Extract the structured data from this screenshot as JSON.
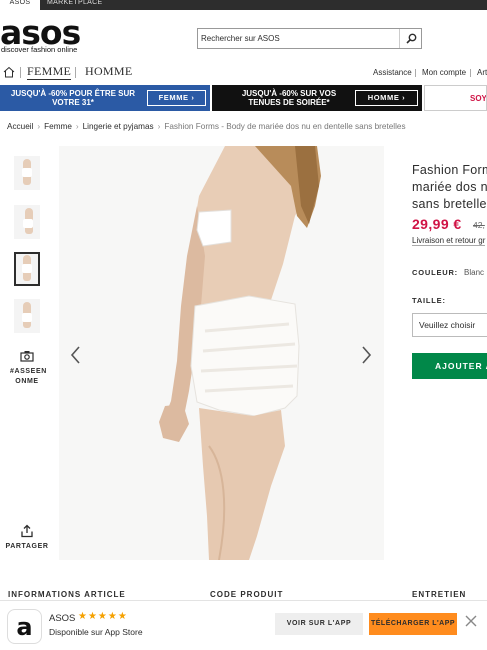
{
  "topbar": {
    "tab_active": "ASOS",
    "tab_marketplace": "MARKETPLACE"
  },
  "logo": {
    "word": "asos",
    "tagline": "discover fashion online"
  },
  "search": {
    "placeholder": "Rechercher sur ASOS"
  },
  "nav": {
    "categories": [
      "FEMME",
      "HOMME"
    ],
    "utilities": [
      "Assistance",
      "Mon compte",
      "Art"
    ]
  },
  "promos": [
    {
      "text": "JUSQU'À -60% POUR ÊTRE SUR VOTRE 31*",
      "button": "FEMME ›",
      "bg": "#2b5aa5"
    },
    {
      "text": "JUSQU'À -60% SUR VOS TENUES DE SOIRÉE*",
      "button": "HOMME ›",
      "bg": "#111111"
    },
    {
      "text": "SOYE",
      "accent": "#d01345"
    }
  ],
  "breadcrumb": [
    "Accueil",
    "Femme",
    "Lingerie et pyjamas",
    "Fashion Forms - Body de mariée dos nu en dentelle sans bretelles"
  ],
  "gallery": {
    "thumb_count": 4,
    "selected_index": 2,
    "share_tag": "#ASSEEN ONME",
    "share_label": "PARTAGER"
  },
  "product": {
    "title_lines": [
      "Fashion Form",
      "mariée dos n",
      "sans bretelles"
    ],
    "price": "29,99 €",
    "old_price": "42,",
    "price_color": "#d01345",
    "delivery": "Livraison et retour gr",
    "color_label": "COULEUR:",
    "color_value": "Blanc",
    "size_label": "TAILLE:",
    "size_placeholder": "Veuillez choisir",
    "add_button": "AJOUTER A",
    "add_color": "#018849"
  },
  "below_headings": [
    "INFORMATIONS ARTICLE",
    "CODE PRODUIT",
    "ENTRETIEN"
  ],
  "app_banner": {
    "icon_letter": "a",
    "name": "ASOS",
    "rating_stars": "★★★★★",
    "rating": 5,
    "subtitle": "Disponible sur App Store",
    "see_button": "VOIR SUR L'APP",
    "download_button": "TÉLÉCHARGER L'APP",
    "download_color": "#ff8c1e"
  }
}
